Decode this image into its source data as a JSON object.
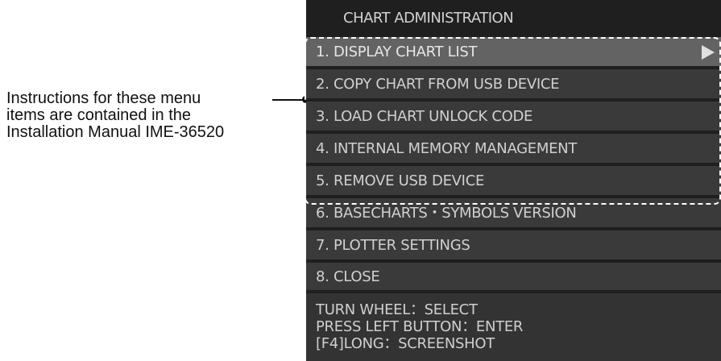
{
  "annotation": {
    "lines": [
      "Instructions for these menu",
      "items are contained in the",
      "Installation Manual IME-36520"
    ]
  },
  "panel": {
    "title": "CHART ADMINISTRATION",
    "items": [
      {
        "label": "1. DISPLAY CHART LIST"
      },
      {
        "label": "2. COPY CHART FROM USB DEVICE"
      },
      {
        "label": "3. LOAD CHART UNLOCK CODE"
      },
      {
        "label": "4. INTERNAL MEMORY MANAGEMENT"
      },
      {
        "label": "5. REMOVE USB DEVICE"
      },
      {
        "label": "6. BASECHARTS・SYMBOLS VERSION"
      },
      {
        "label": "7. PLOTTER SETTINGS"
      },
      {
        "label": "8. CLOSE"
      }
    ],
    "selected_index": 0,
    "footer": [
      "TURN WHEEL：SELECT",
      "PRESS LEFT BUTTON：ENTER",
      "[F4]LONG：SCREENSHOT"
    ]
  },
  "colors": {
    "panel_bg": "#1f1f1f",
    "item_bg": "#3a3a3a",
    "selected_bg": "#636363",
    "highlight_border": "#ffffff"
  },
  "icons": {
    "submenu": "triangle-right-icon"
  }
}
